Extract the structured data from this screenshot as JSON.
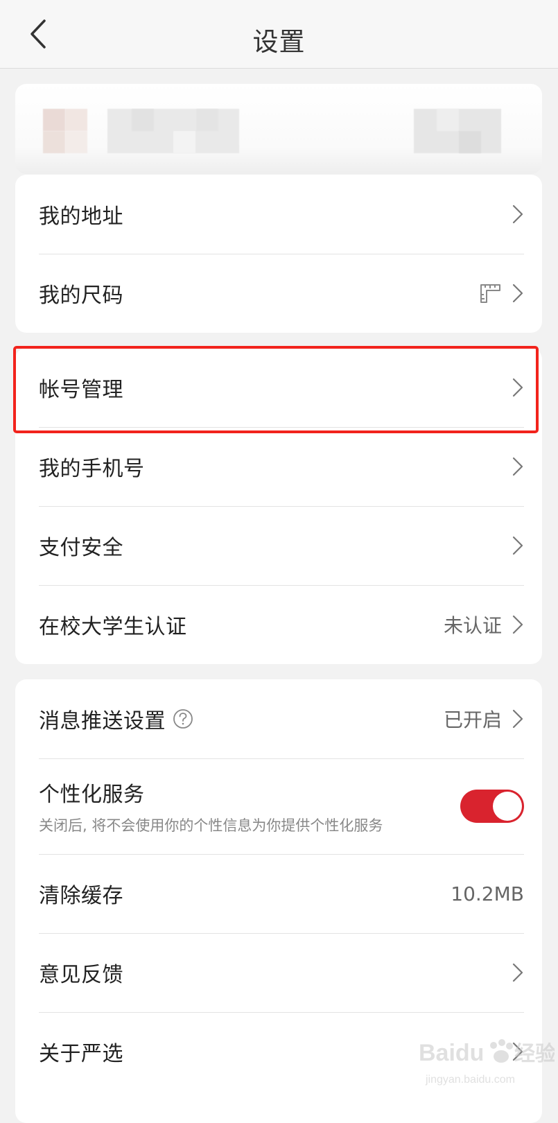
{
  "header": {
    "title": "设置"
  },
  "account_group": {
    "items": [
      {
        "label": "我的地址"
      },
      {
        "label": "我的尺码"
      }
    ]
  },
  "security_group": {
    "items": [
      {
        "label": "帐号管理"
      },
      {
        "label": "我的手机号"
      },
      {
        "label": "支付安全"
      },
      {
        "label": "在校大学生认证",
        "value": "未认证"
      }
    ]
  },
  "other_group": {
    "push": {
      "label": "消息推送设置",
      "value": "已开启"
    },
    "personalized": {
      "label": "个性化服务",
      "description": "关闭后, 将不会使用你的个性信息为你提供个性化服务",
      "enabled": true
    },
    "cache": {
      "label": "清除缓存",
      "value": "10.2MB"
    },
    "feedback": {
      "label": "意见反馈"
    },
    "about": {
      "label": "关于严选"
    }
  },
  "watermark": {
    "brand": "Baidu",
    "cn": "经验",
    "url": "jingyan.baidu.com"
  },
  "colors": {
    "accent": "#d9232e",
    "highlight": "#f2231c"
  }
}
